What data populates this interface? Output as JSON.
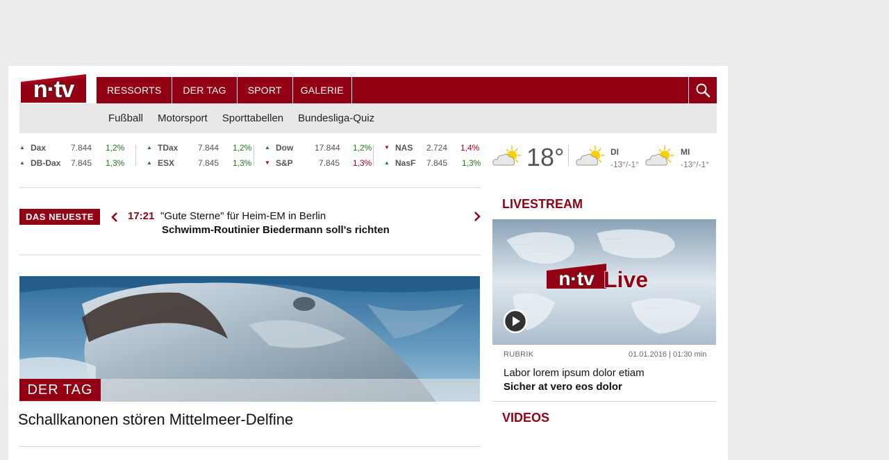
{
  "header": {
    "logo_text": "n·tv",
    "nav": [
      "RESSORTS",
      "DER TAG",
      "SPORT",
      "GALERIE"
    ],
    "subnav": [
      "Fußball",
      "Motorsport",
      "Sporttabellen",
      "Bundesliga-Quiz"
    ]
  },
  "stocks": [
    {
      "name": "Dax",
      "value": "7.844",
      "change": "1,2%",
      "direction": "up"
    },
    {
      "name": "DB-Dax",
      "value": "7.845",
      "change": "1,3%",
      "direction": "up"
    },
    {
      "name": "TDax",
      "value": "7.844",
      "change": "1,2%",
      "direction": "up"
    },
    {
      "name": "ESX",
      "value": "7.845",
      "change": "1,3%",
      "direction": "up"
    },
    {
      "name": "Dow",
      "value": "17.844",
      "change": "1,2%",
      "direction": "up"
    },
    {
      "name": "S&P",
      "value": "7.845",
      "change": "1,3%",
      "direction": "down"
    },
    {
      "name": "NAS",
      "value": "2.724",
      "change": "1,4%",
      "direction": "down"
    },
    {
      "name": "NasF",
      "value": "7.845",
      "change": "1,3%",
      "direction": "up"
    }
  ],
  "weather": {
    "current_temp": "18°",
    "forecast": [
      {
        "day": "DI",
        "range": "-13°/-1°"
      },
      {
        "day": "MI",
        "range": "-13°/-1°"
      }
    ]
  },
  "news": {
    "badge": "DAS NEUESTE",
    "time": "17:21",
    "line1": "\"Gute Sterne\" für Heim-EM in Berlin",
    "line2": "Schwimm-Routinier Biedermann soll's richten"
  },
  "hero": {
    "label": "DER TAG",
    "title": "Schallkanonen stören Mittelmeer-Delfine"
  },
  "livestream": {
    "heading": "LIVESTREAM",
    "logo_text": "n·tv",
    "live_text": "Live",
    "rubrik": "RUBRIK",
    "meta": "01.01.2016 | 01:30 min",
    "line1": "Labor lorem ipsum dolor etiam",
    "line2": "Sicher at vero eos dolor"
  },
  "videos": {
    "heading": "VIDEOS"
  },
  "colors": {
    "brand": "#940013",
    "up": "#1f7a1f",
    "down": "#b0001a"
  }
}
